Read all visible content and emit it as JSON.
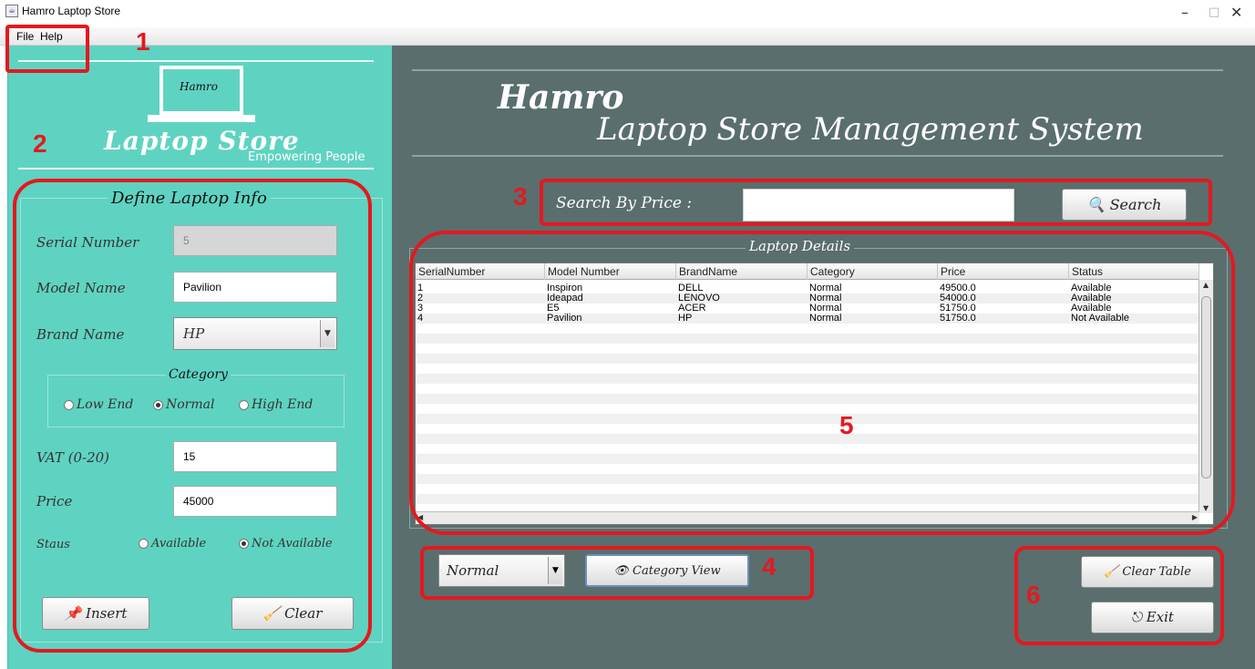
{
  "window": {
    "title": "Hamro Laptop Store",
    "controls": [
      "–",
      "□",
      "✕"
    ]
  },
  "menu": {
    "file": "File",
    "help": "Help"
  },
  "logo": {
    "top_word": "Hamro",
    "main": "Laptop Store",
    "tagline": "Empowering People"
  },
  "form": {
    "title": "Define Laptop Info",
    "serial_label": "Serial Number",
    "serial_value": "5",
    "model_label": "Model Name",
    "model_value": "Pavilion",
    "brand_label": "Brand Name",
    "brand_value": "HP",
    "category_title": "Category",
    "category_options": [
      "Low End",
      "Normal",
      "High End"
    ],
    "category_selected": "Normal",
    "vat_label": "VAT (0-20)",
    "vat_value": "15",
    "price_label": "Price",
    "price_value": "45000",
    "status_label": "Staus",
    "status_options": [
      "Available",
      "Not Available"
    ],
    "status_selected": "Not Available",
    "insert_label": "Insert",
    "clear_label": "Clear"
  },
  "header": {
    "hamro": "Hamro",
    "title": "Laptop Store Management System"
  },
  "search": {
    "label": "Search By Price :",
    "value": "",
    "button": "Search"
  },
  "details": {
    "title": "Laptop Details",
    "columns": [
      "SerialNumber",
      "Model Number",
      "BrandName",
      "Category",
      "Price",
      "Status"
    ],
    "rows": [
      [
        "1",
        "Inspiron",
        "DELL",
        "Normal",
        "49500.0",
        "Available"
      ],
      [
        "2",
        "Ideapad",
        "LENOVO",
        "Normal",
        "54000.0",
        "Available"
      ],
      [
        "3",
        "E5",
        "ACER",
        "Normal",
        "51750.0",
        "Available"
      ],
      [
        "4",
        "Pavilion",
        "HP",
        "Normal",
        "51750.0",
        "Not Available"
      ]
    ]
  },
  "category_filter": {
    "value": "Normal",
    "view_button": "Category View"
  },
  "actions": {
    "clear_table": "Clear Table",
    "exit": "Exit"
  },
  "annotations": [
    "1",
    "2",
    "3",
    "4",
    "5",
    "6"
  ],
  "colors": {
    "left_panel": "#5fd3c1",
    "right_panel": "#5a6e6e",
    "annotation": "#e3191f"
  }
}
